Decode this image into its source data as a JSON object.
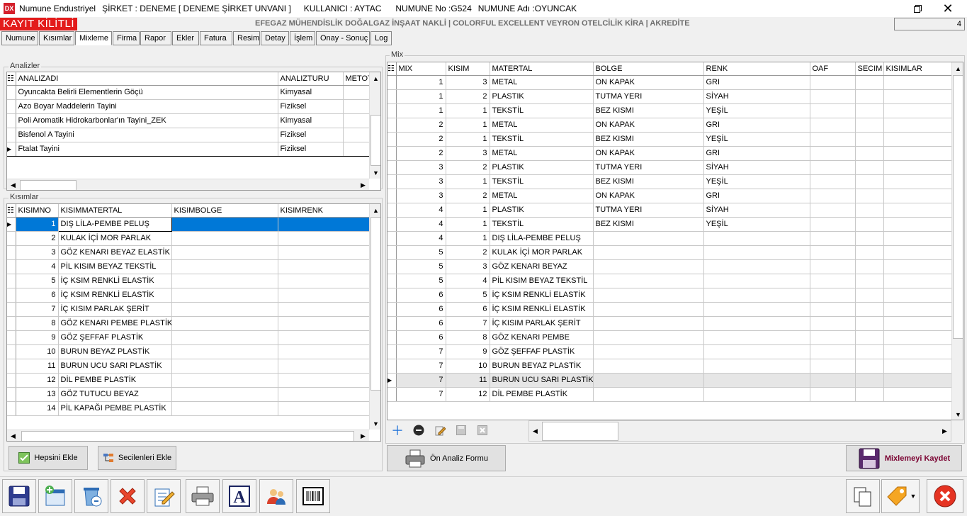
{
  "window": {
    "app_name": "Numune Endustriyel",
    "company": "ŞİRKET : DENEME [ DENEME ŞİRKET UNVANI ]",
    "user": "KULLANICI : AYTAC",
    "sample_no": "NUMUNE No :G524",
    "sample_name": "NUMUNE Adı :OYUNCAK"
  },
  "lock_label": "KAYIT KİLİTLİ",
  "company_line": "EFEGAZ MÜHENDİSLİK DOĞALGAZ İNŞAAT NAKLİ | COLORFUL EXCELLENT VEYRON OTELCİLİK KİRA | AKREDİTE",
  "counter_value": "4",
  "tabs": [
    "Numune",
    "Kısımlar",
    "Mixleme",
    "Firma",
    "Rapor",
    "Ekler",
    "Fatura",
    "Resim",
    "Detay",
    "İşlem",
    "Onay - Sonuç",
    "Log"
  ],
  "active_tab": "Mixleme",
  "analizler": {
    "label": "Analizler",
    "columns": [
      "ANALIZADI",
      "ANALIZTURU",
      "METOT"
    ],
    "rows": [
      [
        "Oyuncakta Belirli Elementlerin Göçü",
        "Kimyasal",
        ""
      ],
      [
        "Azo Boyar Maddelerin Tayini",
        "Fiziksel",
        ""
      ],
      [
        "Poli Aromatik Hidrokarbonlar'ın Tayini_ZEK",
        "Kimyasal",
        ""
      ],
      [
        "Bisfenol A Tayini",
        "Fiziksel",
        ""
      ],
      [
        "Ftalat Tayini",
        "Fiziksel",
        ""
      ]
    ]
  },
  "kisimlar": {
    "label": "Kısımlar",
    "columns": [
      "KISIMNO",
      "KISIMMATERTAL",
      "KISIMBOLGE",
      "KISIMRENK"
    ],
    "rows": [
      [
        "1",
        "DIŞ LİLA-PEMBE PELUŞ",
        "",
        ""
      ],
      [
        "2",
        "KULAK İÇİ MOR PARLAK",
        "",
        ""
      ],
      [
        "3",
        "GÖZ KENARI BEYAZ ELASTİK",
        "",
        ""
      ],
      [
        "4",
        "PİL KISIM BEYAZ TEKSTİL",
        "",
        ""
      ],
      [
        "5",
        "İÇ KSIM RENKLİ ELASTİK",
        "",
        ""
      ],
      [
        "6",
        "İÇ KSIM RENKLİ ELASTİK",
        "",
        ""
      ],
      [
        "7",
        "İÇ KISIM PARLAK ŞERİT",
        "",
        ""
      ],
      [
        "8",
        "GÖZ KENARI PEMBE PLASTİK",
        "",
        ""
      ],
      [
        "9",
        "GÖZ ŞEFFAF PLASTİK",
        "",
        ""
      ],
      [
        "10",
        "BURUN BEYAZ PLASTİK",
        "",
        ""
      ],
      [
        "11",
        "BURUN UCU SARI PLASTİK",
        "",
        ""
      ],
      [
        "12",
        "DİL PEMBE PLASTİK",
        "",
        ""
      ],
      [
        "13",
        "GÖZ TUTUCU BEYAZ",
        "",
        ""
      ],
      [
        "14",
        "PİL KAPAĞI PEMBE PLASTİK",
        "",
        ""
      ]
    ],
    "btn_add_all": "Hepsini Ekle",
    "btn_add_selected": "Secilenleri Ekle"
  },
  "mix": {
    "label": "Mix",
    "columns": [
      "MIX",
      "KISIM",
      "MATERTAL",
      "BOLGE",
      "RENK",
      "OAF",
      "SECIM",
      "KISIMLAR"
    ],
    "rows": [
      [
        "1",
        "3",
        "METAL",
        "ON KAPAK",
        "GRI",
        "",
        "",
        ""
      ],
      [
        "1",
        "2",
        "PLASTIK",
        "TUTMA YERI",
        "SİYAH",
        "",
        "",
        ""
      ],
      [
        "1",
        "1",
        "TEKSTİL",
        "BEZ KISMI",
        "YEŞİL",
        "",
        "",
        ""
      ],
      [
        "2",
        "1",
        "METAL",
        "ON KAPAK",
        "GRI",
        "",
        "",
        ""
      ],
      [
        "2",
        "1",
        "TEKSTİL",
        "BEZ KISMI",
        "YEŞİL",
        "",
        "",
        ""
      ],
      [
        "2",
        "3",
        "METAL",
        "ON KAPAK",
        "GRI",
        "",
        "",
        ""
      ],
      [
        "3",
        "2",
        "PLASTIK",
        "TUTMA YERI",
        "SİYAH",
        "",
        "",
        ""
      ],
      [
        "3",
        "1",
        "TEKSTİL",
        "BEZ KISMI",
        "YEŞİL",
        "",
        "",
        ""
      ],
      [
        "3",
        "2",
        "METAL",
        "ON KAPAK",
        "GRI",
        "",
        "",
        ""
      ],
      [
        "4",
        "1",
        "PLASTIK",
        "TUTMA YERI",
        "SİYAH",
        "",
        "",
        ""
      ],
      [
        "4",
        "1",
        "TEKSTİL",
        "BEZ KISMI",
        "YEŞİL",
        "",
        "",
        ""
      ],
      [
        "4",
        "1",
        "DIŞ LİLA-PEMBE PELUŞ",
        "",
        "",
        "",
        "",
        ""
      ],
      [
        "5",
        "2",
        "KULAK İÇİ MOR PARLAK",
        "",
        "",
        "",
        "",
        ""
      ],
      [
        "5",
        "3",
        "GÖZ KENARI BEYAZ",
        "",
        "",
        "",
        "",
        ""
      ],
      [
        "5",
        "4",
        "PİL KISIM BEYAZ TEKSTİL",
        "",
        "",
        "",
        "",
        ""
      ],
      [
        "6",
        "5",
        "İÇ KSIM RENKLİ ELASTİK",
        "",
        "",
        "",
        "",
        ""
      ],
      [
        "6",
        "6",
        "İÇ KSIM RENKLİ ELASTİK",
        "",
        "",
        "",
        "",
        ""
      ],
      [
        "6",
        "7",
        "İÇ KISIM PARLAK ŞERİT",
        "",
        "",
        "",
        "",
        ""
      ],
      [
        "6",
        "8",
        "GÖZ KENARI PEMBE",
        "",
        "",
        "",
        "",
        ""
      ],
      [
        "7",
        "9",
        "GÖZ ŞEFFAF PLASTİK",
        "",
        "",
        "",
        "",
        ""
      ],
      [
        "7",
        "10",
        "BURUN BEYAZ PLASTİK",
        "",
        "",
        "",
        "",
        ""
      ],
      [
        "7",
        "11",
        "BURUN UCU SARI PLASTİK",
        "",
        "",
        "",
        "",
        ""
      ],
      [
        "7",
        "12",
        "DİL PEMBE PLASTİK",
        "",
        "",
        "",
        "",
        ""
      ]
    ],
    "btn_pre_analysis": "Ön Analiz Formu",
    "btn_save_mix": "Mixlemeyi Kaydet"
  },
  "colors": {
    "lock_bg": "#e31b1b",
    "selection": "#0078d7",
    "save_mix_text": "#7a0030"
  }
}
